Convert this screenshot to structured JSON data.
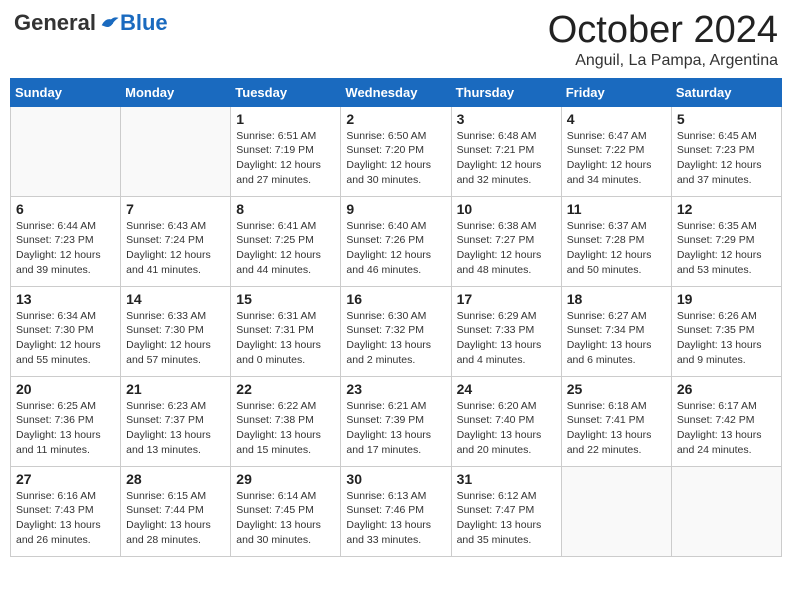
{
  "header": {
    "logo_general": "General",
    "logo_blue": "Blue",
    "month_title": "October 2024",
    "location": "Anguil, La Pampa, Argentina"
  },
  "days_of_week": [
    "Sunday",
    "Monday",
    "Tuesday",
    "Wednesday",
    "Thursday",
    "Friday",
    "Saturday"
  ],
  "weeks": [
    [
      {
        "day": "",
        "info": ""
      },
      {
        "day": "",
        "info": ""
      },
      {
        "day": "1",
        "info": "Sunrise: 6:51 AM\nSunset: 7:19 PM\nDaylight: 12 hours\nand 27 minutes."
      },
      {
        "day": "2",
        "info": "Sunrise: 6:50 AM\nSunset: 7:20 PM\nDaylight: 12 hours\nand 30 minutes."
      },
      {
        "day": "3",
        "info": "Sunrise: 6:48 AM\nSunset: 7:21 PM\nDaylight: 12 hours\nand 32 minutes."
      },
      {
        "day": "4",
        "info": "Sunrise: 6:47 AM\nSunset: 7:22 PM\nDaylight: 12 hours\nand 34 minutes."
      },
      {
        "day": "5",
        "info": "Sunrise: 6:45 AM\nSunset: 7:23 PM\nDaylight: 12 hours\nand 37 minutes."
      }
    ],
    [
      {
        "day": "6",
        "info": "Sunrise: 6:44 AM\nSunset: 7:23 PM\nDaylight: 12 hours\nand 39 minutes."
      },
      {
        "day": "7",
        "info": "Sunrise: 6:43 AM\nSunset: 7:24 PM\nDaylight: 12 hours\nand 41 minutes."
      },
      {
        "day": "8",
        "info": "Sunrise: 6:41 AM\nSunset: 7:25 PM\nDaylight: 12 hours\nand 44 minutes."
      },
      {
        "day": "9",
        "info": "Sunrise: 6:40 AM\nSunset: 7:26 PM\nDaylight: 12 hours\nand 46 minutes."
      },
      {
        "day": "10",
        "info": "Sunrise: 6:38 AM\nSunset: 7:27 PM\nDaylight: 12 hours\nand 48 minutes."
      },
      {
        "day": "11",
        "info": "Sunrise: 6:37 AM\nSunset: 7:28 PM\nDaylight: 12 hours\nand 50 minutes."
      },
      {
        "day": "12",
        "info": "Sunrise: 6:35 AM\nSunset: 7:29 PM\nDaylight: 12 hours\nand 53 minutes."
      }
    ],
    [
      {
        "day": "13",
        "info": "Sunrise: 6:34 AM\nSunset: 7:30 PM\nDaylight: 12 hours\nand 55 minutes."
      },
      {
        "day": "14",
        "info": "Sunrise: 6:33 AM\nSunset: 7:30 PM\nDaylight: 12 hours\nand 57 minutes."
      },
      {
        "day": "15",
        "info": "Sunrise: 6:31 AM\nSunset: 7:31 PM\nDaylight: 13 hours\nand 0 minutes."
      },
      {
        "day": "16",
        "info": "Sunrise: 6:30 AM\nSunset: 7:32 PM\nDaylight: 13 hours\nand 2 minutes."
      },
      {
        "day": "17",
        "info": "Sunrise: 6:29 AM\nSunset: 7:33 PM\nDaylight: 13 hours\nand 4 minutes."
      },
      {
        "day": "18",
        "info": "Sunrise: 6:27 AM\nSunset: 7:34 PM\nDaylight: 13 hours\nand 6 minutes."
      },
      {
        "day": "19",
        "info": "Sunrise: 6:26 AM\nSunset: 7:35 PM\nDaylight: 13 hours\nand 9 minutes."
      }
    ],
    [
      {
        "day": "20",
        "info": "Sunrise: 6:25 AM\nSunset: 7:36 PM\nDaylight: 13 hours\nand 11 minutes."
      },
      {
        "day": "21",
        "info": "Sunrise: 6:23 AM\nSunset: 7:37 PM\nDaylight: 13 hours\nand 13 minutes."
      },
      {
        "day": "22",
        "info": "Sunrise: 6:22 AM\nSunset: 7:38 PM\nDaylight: 13 hours\nand 15 minutes."
      },
      {
        "day": "23",
        "info": "Sunrise: 6:21 AM\nSunset: 7:39 PM\nDaylight: 13 hours\nand 17 minutes."
      },
      {
        "day": "24",
        "info": "Sunrise: 6:20 AM\nSunset: 7:40 PM\nDaylight: 13 hours\nand 20 minutes."
      },
      {
        "day": "25",
        "info": "Sunrise: 6:18 AM\nSunset: 7:41 PM\nDaylight: 13 hours\nand 22 minutes."
      },
      {
        "day": "26",
        "info": "Sunrise: 6:17 AM\nSunset: 7:42 PM\nDaylight: 13 hours\nand 24 minutes."
      }
    ],
    [
      {
        "day": "27",
        "info": "Sunrise: 6:16 AM\nSunset: 7:43 PM\nDaylight: 13 hours\nand 26 minutes."
      },
      {
        "day": "28",
        "info": "Sunrise: 6:15 AM\nSunset: 7:44 PM\nDaylight: 13 hours\nand 28 minutes."
      },
      {
        "day": "29",
        "info": "Sunrise: 6:14 AM\nSunset: 7:45 PM\nDaylight: 13 hours\nand 30 minutes."
      },
      {
        "day": "30",
        "info": "Sunrise: 6:13 AM\nSunset: 7:46 PM\nDaylight: 13 hours\nand 33 minutes."
      },
      {
        "day": "31",
        "info": "Sunrise: 6:12 AM\nSunset: 7:47 PM\nDaylight: 13 hours\nand 35 minutes."
      },
      {
        "day": "",
        "info": ""
      },
      {
        "day": "",
        "info": ""
      }
    ]
  ]
}
